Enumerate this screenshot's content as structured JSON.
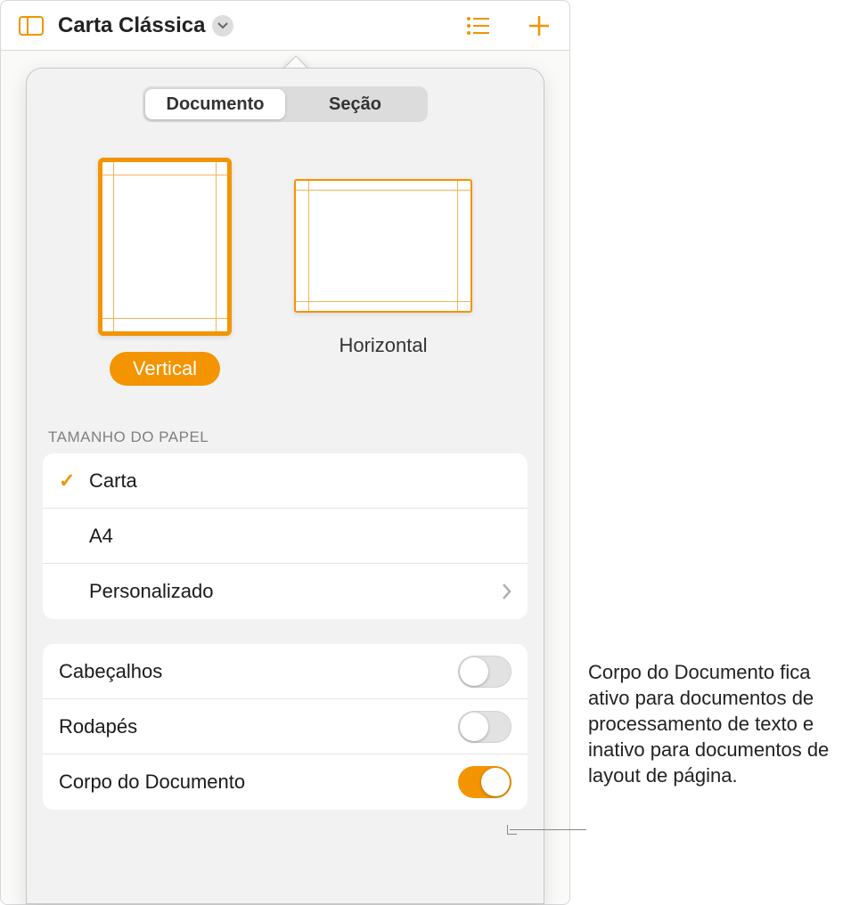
{
  "toolbar": {
    "title": "Carta Clássica"
  },
  "tabs": {
    "documento": "Documento",
    "secao": "Seção"
  },
  "orientation": {
    "vertical": "Vertical",
    "horizontal": "Horizontal"
  },
  "paper": {
    "header": "Tamanho do Papel",
    "options": {
      "carta": "Carta",
      "a4": "A4",
      "custom": "Personalizado"
    }
  },
  "toggles": {
    "headers": {
      "label": "Cabeçalhos",
      "on": false
    },
    "footers": {
      "label": "Rodapés",
      "on": false
    },
    "body": {
      "label": "Corpo do Documento",
      "on": true
    }
  },
  "callout": "Corpo do Documento fica ativo para documentos de processamento de texto e inativo para documentos de layout de página."
}
